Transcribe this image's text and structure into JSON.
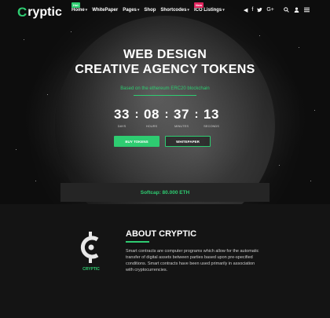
{
  "brand": {
    "logo_mark": "C",
    "logo_text": "ryptic"
  },
  "nav": {
    "items": [
      {
        "label": "Home",
        "badge": "Hot",
        "has_dropdown": true
      },
      {
        "label": "WhitePaper",
        "badge": "",
        "has_dropdown": false
      },
      {
        "label": "Pages",
        "badge": "",
        "has_dropdown": true
      },
      {
        "label": "Shop",
        "badge": "",
        "has_dropdown": false
      },
      {
        "label": "Shortcodes",
        "badge": "",
        "has_dropdown": true
      },
      {
        "label": "ICO Listings",
        "badge": "New",
        "has_dropdown": true
      }
    ],
    "social_icons": [
      "telegram-icon",
      "facebook-icon",
      "twitter-icon",
      "google-plus-icon"
    ],
    "social_glyphs": [
      "◀",
      "f",
      "🐦",
      "G+"
    ],
    "tools_icons": [
      "search-icon",
      "user-icon",
      "menu-icon"
    ]
  },
  "hero": {
    "title_line1": "WEB DESIGN",
    "title_line2": "CREATIVE AGENCY TOKENS",
    "subtitle": "Based on the ethereum ERC20 blockchain",
    "countdown": [
      {
        "value": "33",
        "label": "DAYS"
      },
      {
        "value": "08",
        "label": "HOURS"
      },
      {
        "value": "37",
        "label": "MINUTES"
      },
      {
        "value": "13",
        "label": "SECONDS"
      }
    ],
    "buy_button": "BUY TOKENS",
    "whitepaper_button": "WHITEPAPER"
  },
  "softcap": {
    "text": "Softcap: 80.000 ETH"
  },
  "about": {
    "title": "ABOUT CRYPTIC",
    "logo_label": "CRYPTIC",
    "text": "Smart contracts are computer programs which allow for the automatic transfer of digital assets between parties based upon pre-specified conditions. Smart contracts have been used primarily in association with cryptocurrencies."
  },
  "colors": {
    "accent": "#2ecc71",
    "badge_hot": "#2ecc71",
    "badge_new": "#e0245e",
    "background": "#141414"
  }
}
